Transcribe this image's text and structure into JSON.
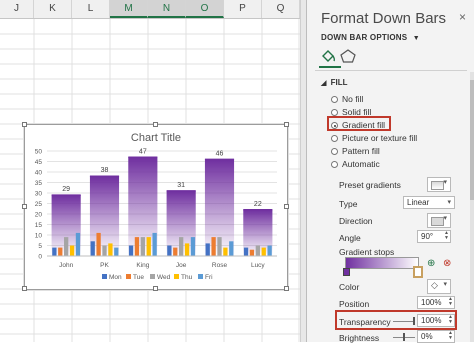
{
  "spreadsheet": {
    "columns": [
      "J",
      "K",
      "L",
      "M",
      "N",
      "O",
      "P",
      "Q"
    ],
    "selected_columns": [
      "M",
      "N",
      "O"
    ]
  },
  "chart_data": {
    "type": "bar",
    "title": "Chart Title",
    "categories": [
      "John",
      "PK",
      "King",
      "Joe",
      "Rose",
      "Lucy"
    ],
    "series": [
      {
        "name": "Mon",
        "color": "#4472c4",
        "values": [
          4,
          7,
          5,
          5,
          6,
          4
        ]
      },
      {
        "name": "Tue",
        "color": "#ed7d31",
        "values": [
          4,
          11,
          9,
          4,
          9,
          3
        ]
      },
      {
        "name": "Wed",
        "color": "#a5a5a5",
        "values": [
          9,
          5,
          9,
          9,
          9,
          5
        ]
      },
      {
        "name": "Thu",
        "color": "#ffc000",
        "values": [
          5,
          6,
          9,
          6,
          4,
          4
        ]
      },
      {
        "name": "Fri",
        "color": "#5b9bd5",
        "values": [
          11,
          4,
          11,
          9,
          7,
          5
        ]
      }
    ],
    "down_bars": {
      "color": "#7030a0",
      "tops": [
        29,
        38,
        47,
        31,
        46,
        22
      ]
    },
    "data_labels": [
      "29",
      "38",
      "47",
      "31",
      "46",
      "22"
    ],
    "ylim": [
      0,
      50
    ],
    "yticks": [
      "0",
      "5",
      "10",
      "15",
      "20",
      "25",
      "30",
      "35",
      "40",
      "45",
      "50"
    ],
    "legend_position": "bottom"
  },
  "panel": {
    "title": "Format Down Bars",
    "close": "×",
    "section": "DOWN BAR OPTIONS",
    "fill_header": "FILL",
    "fill_options": [
      "No fill",
      "Solid fill",
      "Gradient fill",
      "Picture or texture fill",
      "Pattern fill",
      "Automatic"
    ],
    "selected_fill": "Gradient fill",
    "preset_gradients_label": "Preset gradients",
    "type_label": "Type",
    "type_value": "Linear",
    "direction_label": "Direction",
    "angle_label": "Angle",
    "angle_value": "90°",
    "gradient_stops_label": "Gradient stops",
    "color_label": "Color",
    "position_label": "Position",
    "position_value": "100%",
    "transparency_label": "Transparency",
    "transparency_value": "100%",
    "brightness_label": "Brightness",
    "brightness_value": "0%",
    "accent": "#217346",
    "highlight": "#c0392b"
  }
}
